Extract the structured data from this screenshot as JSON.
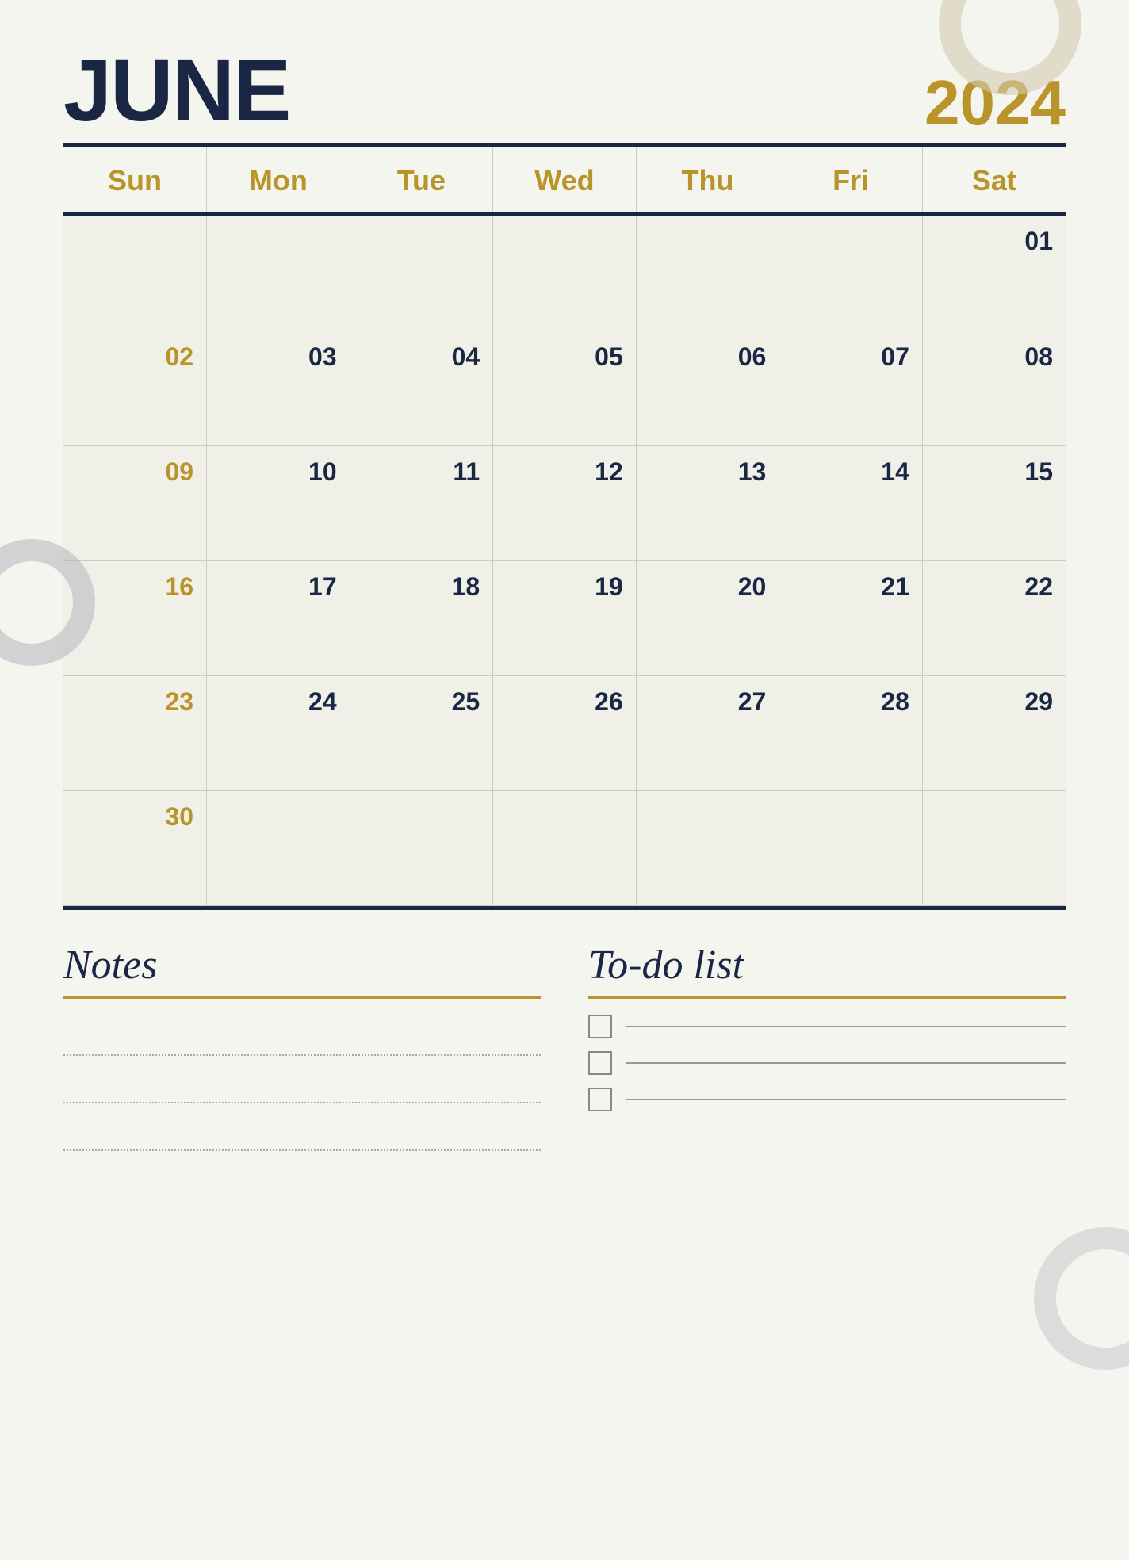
{
  "header": {
    "month": "JUNE",
    "year": "2024"
  },
  "calendar": {
    "days_of_week": [
      "Sun",
      "Mon",
      "Tue",
      "Wed",
      "Thu",
      "Fri",
      "Sat"
    ],
    "weeks": [
      [
        {
          "date": "",
          "type": "empty"
        },
        {
          "date": "",
          "type": "empty"
        },
        {
          "date": "",
          "type": "empty"
        },
        {
          "date": "",
          "type": "empty"
        },
        {
          "date": "",
          "type": "empty"
        },
        {
          "date": "",
          "type": "empty"
        },
        {
          "date": "01",
          "type": "sat"
        }
      ],
      [
        {
          "date": "02",
          "type": "sun"
        },
        {
          "date": "03",
          "type": "weekday"
        },
        {
          "date": "04",
          "type": "weekday"
        },
        {
          "date": "05",
          "type": "weekday"
        },
        {
          "date": "06",
          "type": "weekday"
        },
        {
          "date": "07",
          "type": "weekday"
        },
        {
          "date": "08",
          "type": "sat"
        }
      ],
      [
        {
          "date": "09",
          "type": "sun"
        },
        {
          "date": "10",
          "type": "weekday"
        },
        {
          "date": "11",
          "type": "weekday"
        },
        {
          "date": "12",
          "type": "weekday"
        },
        {
          "date": "13",
          "type": "weekday"
        },
        {
          "date": "14",
          "type": "weekday"
        },
        {
          "date": "15",
          "type": "sat"
        }
      ],
      [
        {
          "date": "16",
          "type": "sun"
        },
        {
          "date": "17",
          "type": "weekday"
        },
        {
          "date": "18",
          "type": "weekday"
        },
        {
          "date": "19",
          "type": "weekday"
        },
        {
          "date": "20",
          "type": "weekday"
        },
        {
          "date": "21",
          "type": "weekday"
        },
        {
          "date": "22",
          "type": "sat"
        }
      ],
      [
        {
          "date": "23",
          "type": "sun"
        },
        {
          "date": "24",
          "type": "weekday"
        },
        {
          "date": "25",
          "type": "weekday"
        },
        {
          "date": "26",
          "type": "weekday"
        },
        {
          "date": "27",
          "type": "weekday"
        },
        {
          "date": "28",
          "type": "weekday"
        },
        {
          "date": "29",
          "type": "sat"
        }
      ],
      [
        {
          "date": "30",
          "type": "sun"
        },
        {
          "date": "",
          "type": "empty"
        },
        {
          "date": "",
          "type": "empty"
        },
        {
          "date": "",
          "type": "empty"
        },
        {
          "date": "",
          "type": "empty"
        },
        {
          "date": "",
          "type": "empty"
        },
        {
          "date": "",
          "type": "empty"
        }
      ]
    ]
  },
  "footer": {
    "notes_title": "Notes",
    "todo_title": "To-do list",
    "todo_items": [
      {
        "label": ""
      },
      {
        "label": ""
      },
      {
        "label": ""
      }
    ]
  }
}
